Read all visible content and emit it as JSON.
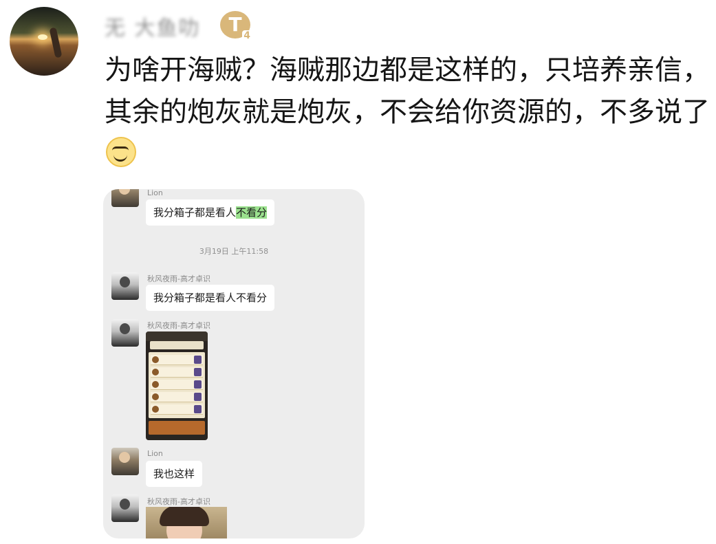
{
  "post": {
    "username": "无 大鱼叻",
    "badge": "T",
    "badge_sub": "4",
    "text": "为啥开海贼？海贼那边都是这样的，只培养亲信，其余的炮灰就是炮灰，不会给你资源的，不多说了",
    "emoji": "smile-emoji"
  },
  "chat": {
    "msg1": {
      "name": "Lion",
      "text_normal": "我分箱子都是看人",
      "text_highlight": "不看分"
    },
    "timestamp": "3月19日 上午11:58",
    "msg2": {
      "name": "秋风夜雨-高才卓识",
      "text": "我分箱子都是看人不看分"
    },
    "msg3": {
      "name": "秋风夜雨-高才卓识",
      "image": "game-screenshot"
    },
    "msg4": {
      "name": "Lion",
      "text": "我也这样"
    },
    "msg5": {
      "name": "秋风夜雨-高才卓识",
      "image": "photo"
    }
  },
  "colors": {
    "chat_bg": "#ededed",
    "highlight": "#9be18e",
    "badge": "#d9b77a"
  }
}
